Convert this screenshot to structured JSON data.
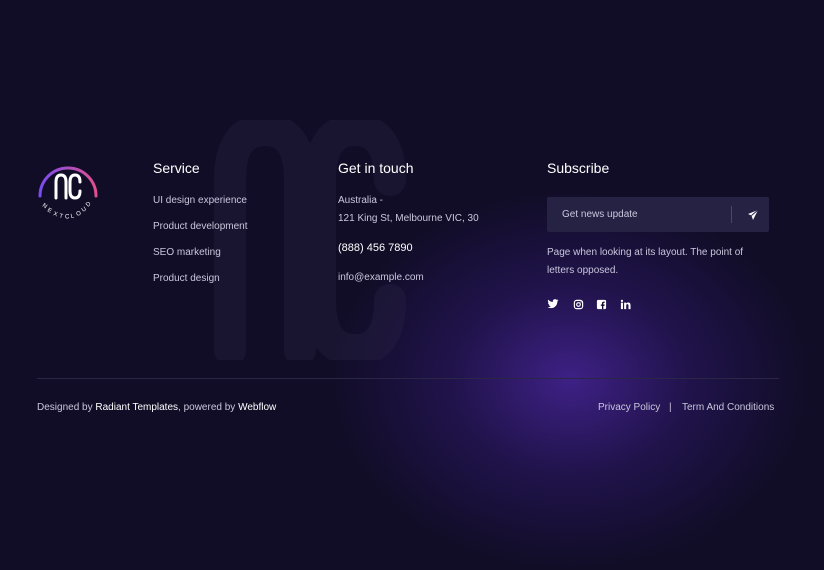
{
  "brand": {
    "logo_text": "NEXTCLOUD",
    "gradient": [
      "#e0508f",
      "#7a4cf0"
    ]
  },
  "service": {
    "title": "Service",
    "links": [
      "UI design experience",
      "Product development",
      "SEO marketing",
      "Product design"
    ]
  },
  "contact": {
    "title": "Get in touch",
    "address_line1": "Australia -",
    "address_line2": "121 King St, Melbourne VIC, 30",
    "phone": "(888) 456 7890",
    "email": "info@example.com"
  },
  "subscribe": {
    "title": "Subscribe",
    "placeholder": "Get news update",
    "send_icon": "paper-plane-icon",
    "description": "Page when looking at its layout. The point of letters opposed.",
    "social_icons": [
      "twitter-icon",
      "instagram-icon",
      "facebook-icon",
      "linkedin-icon"
    ]
  },
  "footer": {
    "designed_by": "Designed by",
    "designer": "Radiant Templates",
    "powered_by": ", powered by",
    "platform": "Webflow",
    "privacy": "Privacy Policy",
    "separator": "|",
    "terms": "Term And Conditions"
  },
  "colors": {
    "background": "#110d27",
    "glow": "#46249a",
    "input_bg": "#262244"
  }
}
